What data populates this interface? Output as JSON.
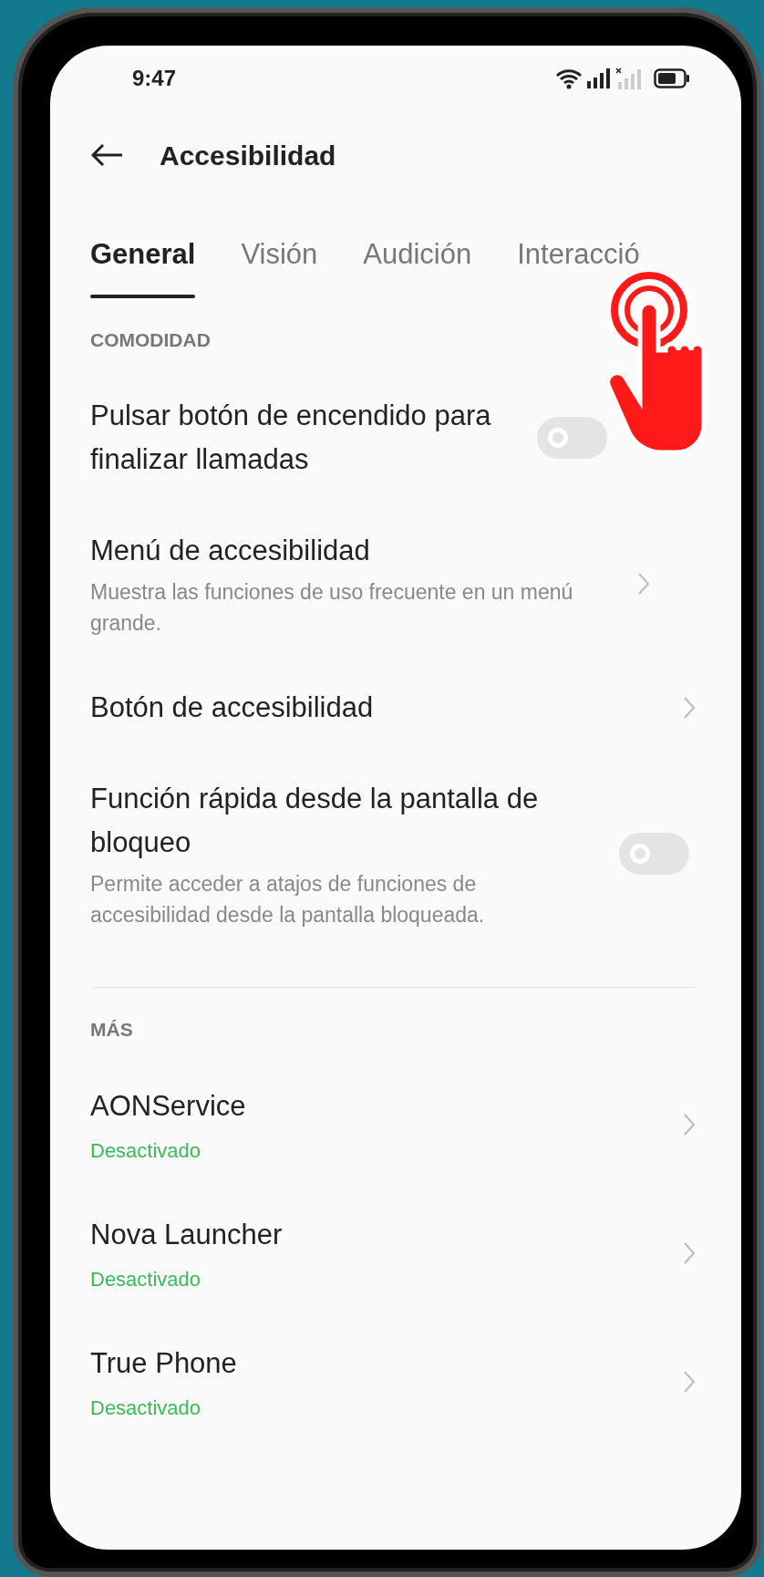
{
  "status_bar": {
    "time": "9:47"
  },
  "header": {
    "title": "Accesibilidad"
  },
  "tabs": [
    {
      "label": "General",
      "selected": true
    },
    {
      "label": "Visión",
      "selected": false
    },
    {
      "label": "Audición",
      "selected": false
    },
    {
      "label": "Interacció",
      "selected": false
    }
  ],
  "sections": [
    {
      "title": "COMODIDAD",
      "items": [
        {
          "kind": "toggle",
          "title": "Pulsar botón de encendido para finalizar llamadas",
          "on": false
        },
        {
          "kind": "link",
          "title": "Menú de accesibilidad",
          "subtitle": "Muestra las funciones de uso frecuente en un menú grande."
        },
        {
          "kind": "link",
          "title": "Botón de accesibilidad"
        },
        {
          "kind": "toggle",
          "title": "Función rápida desde la pantalla de bloqueo",
          "subtitle": "Permite acceder a atajos de funciones de accesibilidad desde la pantalla bloqueada.",
          "on": false
        }
      ]
    },
    {
      "title": "MÁS",
      "items": [
        {
          "kind": "link",
          "title": "AONService",
          "status": "Desactivado"
        },
        {
          "kind": "link",
          "title": "Nova Launcher",
          "status": "Desactivado"
        },
        {
          "kind": "link",
          "title": "True Phone",
          "status": "Desactivado"
        }
      ]
    }
  ]
}
